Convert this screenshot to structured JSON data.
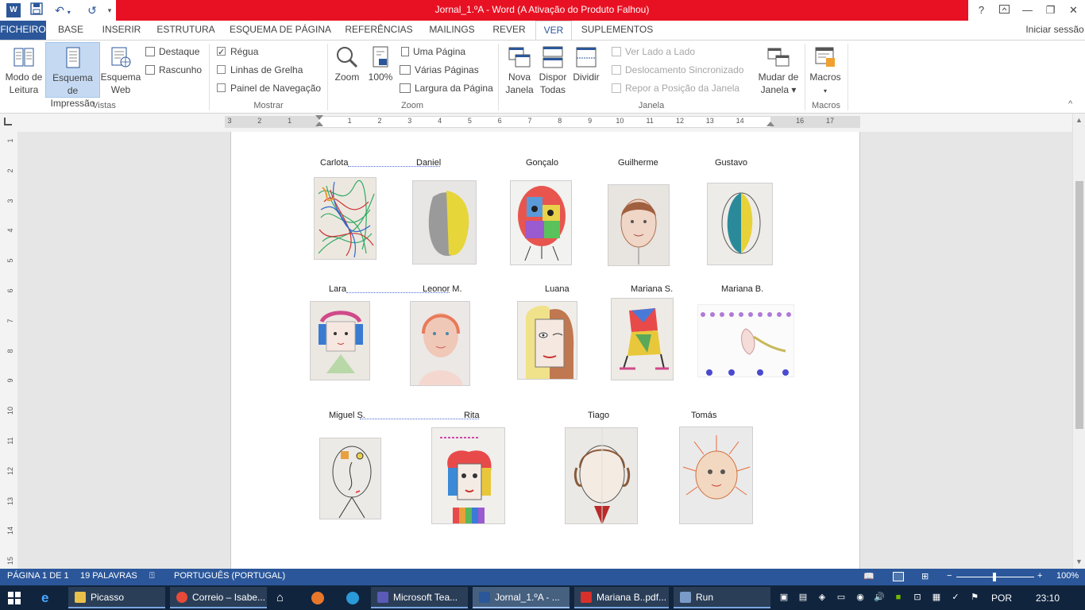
{
  "window": {
    "title": "Jornal_1.ºA -  Word (A Ativação do Produto Falhou)",
    "help": "?",
    "signin": "Iniciar sessão"
  },
  "qat": {
    "customize": "⌅"
  },
  "tabs": [
    "FICHEIRO",
    "BASE",
    "INSERIR",
    "ESTRUTURA",
    "ESQUEMA DE PÁGINA",
    "REFERÊNCIAS",
    "MAILINGS",
    "REVER",
    "VER",
    "SUPLEMENTOS"
  ],
  "ribbon": {
    "vistas": {
      "label": "Vistas",
      "modo_leitura": [
        "Modo de",
        "Leitura"
      ],
      "esquema_impressao": [
        "Esquema de",
        "Impressão"
      ],
      "esquema_web": [
        "Esquema",
        "Web"
      ],
      "destaque": "Destaque",
      "rascunho": "Rascunho"
    },
    "mostrar": {
      "label": "Mostrar",
      "regua": "Régua",
      "linhas_grelha": "Linhas de Grelha",
      "painel_navegacao": "Painel de Navegação"
    },
    "zoom": {
      "label": "Zoom",
      "zoom": "Zoom",
      "cem": "100%",
      "uma_pagina": "Uma Página",
      "varias_paginas": "Várias Páginas",
      "largura_pagina": "Largura da Página"
    },
    "janela": {
      "label": "Janela",
      "nova_janela": [
        "Nova",
        "Janela"
      ],
      "dispor_todas": [
        "Dispor",
        "Todas"
      ],
      "dividir": "Dividir",
      "ver_lado": "Ver Lado a Lado",
      "desloc_sinc": "Deslocamento Sincronizado",
      "repor_pos": "Repor a Posição da Janela",
      "mudar_janela": [
        "Mudar de",
        "Janela ▾"
      ]
    },
    "macros": {
      "label": "Macros",
      "macros": "Macros"
    }
  },
  "ruler": {
    "top": [
      "3",
      "2",
      "1",
      "",
      "1",
      "2",
      "3",
      "4",
      "5",
      "6",
      "7",
      "8",
      "9",
      "10",
      "11",
      "12",
      "13",
      "14",
      "",
      "16",
      "17"
    ],
    "left": [
      "1",
      "2",
      "3",
      "4",
      "5",
      "6",
      "7",
      "8",
      "9",
      "10",
      "11",
      "12",
      "13",
      "14",
      "15"
    ]
  },
  "names": {
    "carlota": "Carlota",
    "daniel": "Daniel",
    "goncalo": "Gonçalo",
    "guilherme": "Guilherme",
    "gustavo": "Gustavo",
    "lara": "Lara",
    "leonor": "Leonor M.",
    "luana": "Luana",
    "mariana_s": "Mariana S.",
    "mariana_b": "Mariana B.",
    "miguel": "Miguel S.",
    "rita": "Rita",
    "tiago": "Tiago",
    "tomas": "Tomás"
  },
  "status": {
    "page": "PÁGINA 1 DE 1",
    "words": "19 PALAVRAS",
    "language": "PORTUGUÊS (PORTUGAL)",
    "zoom": "100%"
  },
  "taskbar": {
    "items": [
      "Picasso",
      "Correio – Isabe...",
      "Microsoft Tea...",
      "Jornal_1.ºA - ...",
      "Mariana B..pdf...",
      "Run"
    ],
    "lang": "POR",
    "time": "23:10"
  },
  "colors": {
    "accent": "#2b579a",
    "titlebar_warning": "#e81123",
    "taskbar": "#10243e"
  }
}
